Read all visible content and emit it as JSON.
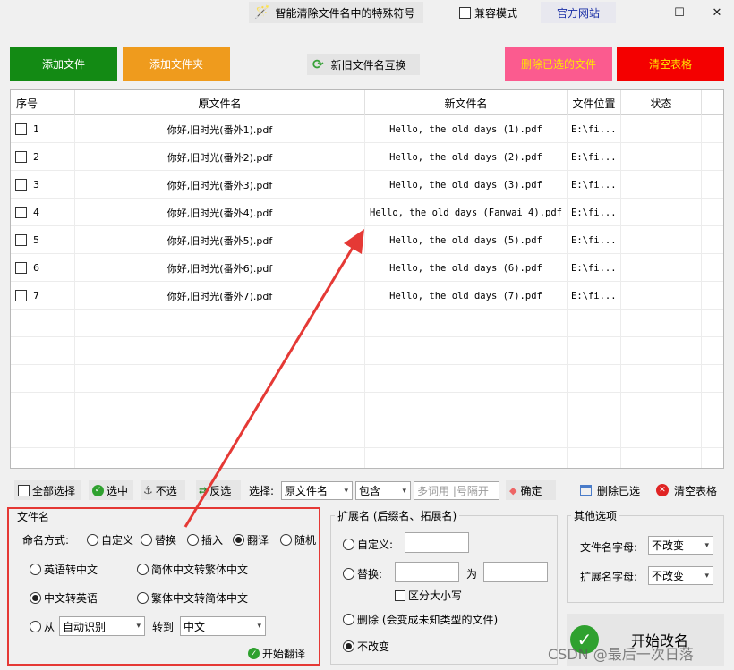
{
  "titlebar": {
    "special_chars_label": "智能清除文件名中的特殊符号",
    "compat_label": "兼容模式",
    "website_label": "官方网站",
    "minimize": "—",
    "maximize": "☐",
    "close": "✕"
  },
  "toolbar": {
    "add_file": "添加文件",
    "add_folder": "添加文件夹",
    "swap_names": "新旧文件名互换",
    "delete_selected": "删除已选的文件",
    "clear_table": "清空表格",
    "colors": {
      "add_file": "#138a14",
      "add_folder": "#ef9b1d",
      "delete_selected": "#fb5b8f",
      "clear_table": "#f40000"
    }
  },
  "table": {
    "headers": [
      "序号",
      "原文件名",
      "新文件名",
      "文件位置",
      "状态"
    ],
    "rows": [
      {
        "no": "1",
        "old": "你好,旧时光(番外1).pdf",
        "new": "Hello, the old days (1).pdf",
        "loc": "E:\\fi...",
        "status": ""
      },
      {
        "no": "2",
        "old": "你好,旧时光(番外2).pdf",
        "new": "Hello, the old days (2).pdf",
        "loc": "E:\\fi...",
        "status": ""
      },
      {
        "no": "3",
        "old": "你好,旧时光(番外3).pdf",
        "new": "Hello, the old days (3).pdf",
        "loc": "E:\\fi...",
        "status": ""
      },
      {
        "no": "4",
        "old": "你好,旧时光(番外4).pdf",
        "new": "Hello, the old days (Fanwai 4).pdf",
        "loc": "E:\\fi...",
        "status": ""
      },
      {
        "no": "5",
        "old": "你好,旧时光(番外5).pdf",
        "new": "Hello, the old days (5).pdf",
        "loc": "E:\\fi...",
        "status": ""
      },
      {
        "no": "6",
        "old": "你好,旧时光(番外6).pdf",
        "new": "Hello, the old days (6).pdf",
        "loc": "E:\\fi...",
        "status": ""
      },
      {
        "no": "7",
        "old": "你好,旧时光(番外7).pdf",
        "new": "Hello, the old days (7).pdf",
        "loc": "E:\\fi...",
        "status": ""
      }
    ]
  },
  "selectbar": {
    "select_all": "全部选择",
    "select": "选中",
    "unselect": "不选",
    "invert": "反选",
    "choose_label": "选择:",
    "field_value": "原文件名",
    "match_value": "包含",
    "keywords_placeholder": "多词用 |号隔开",
    "confirm": "确定",
    "delete_selected": "删除已选",
    "clear_table": "清空表格"
  },
  "filename_group": {
    "title": "文件名",
    "naming_label": "命名方式:",
    "modes": [
      "自定义",
      "替换",
      "插入",
      "翻译",
      "随机"
    ],
    "selected_mode": "翻译",
    "options": [
      "英语转中文",
      "简体中文转繁体中文",
      "中文转英语",
      "繁体中文转简体中文"
    ],
    "selected_option": "中文转英语",
    "from_label": "从",
    "from_value": "自动识别",
    "to_label": "转到",
    "to_value": "中文",
    "start_translate": "开始翻译"
  },
  "ext_group": {
    "title": "扩展名 (后缀名、拓展名)",
    "custom_label": "自定义:",
    "replace_label": "替换:",
    "to_label": "为",
    "case_label": "区分大小写",
    "delete_label": "删除 (会变成未知类型的文件)",
    "unchanged_label": "不改变"
  },
  "other_group": {
    "title": "其他选项",
    "filename_case_label": "文件名字母:",
    "filename_case_value": "不改变",
    "ext_case_label": "扩展名字母:",
    "ext_case_value": "不改变"
  },
  "start_button": "开始改名",
  "watermark": "CSDN @最后一次日落",
  "annotation_color": "#e53935"
}
